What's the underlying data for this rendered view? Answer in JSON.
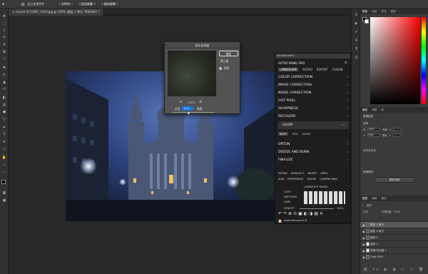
{
  "optionsbar": {
    "checkbox_label": "显示变换控件",
    "zoom": "100%",
    "fit_screen": "适合屏幕",
    "fill_screen": "填充屏幕"
  },
  "document_tab": {
    "label": "church-5173087_1920.jpg @ 100% (图层 1 拷贝, RGB/8#) *"
  },
  "dialog": {
    "title": "高反差保留",
    "ok": "确定",
    "reset": "默认值",
    "preview_label": "预览",
    "zoom": "100%",
    "radius_label": "半径",
    "radius_value": "10.0",
    "unit": "像素"
  },
  "astro": {
    "header": "AstroPanelPro",
    "title": "ASTRO PANEL PRO",
    "tabs": [
      "LANDSCAPE",
      "ASTRO",
      "EXPORT",
      "FUSION"
    ],
    "menu": [
      "COLOR CORRECTION",
      "IMAGE CORRECTION",
      "NOISE CORRECTION",
      "HOT PIXEL",
      "SHARPNESS",
      "RECOVERY"
    ],
    "glow": "GLOW",
    "glow_opts": [
      "SOFT",
      "PRO",
      "NIGHT"
    ],
    "menu2": [
      "ORTON",
      "DODGE AND BURN",
      "FINALIZE"
    ],
    "btns1": [
      "REFINE",
      "DESELECT",
      "INVERT",
      "APPLY"
    ],
    "btns2": [
      "SUM",
      "DIFFERENCE",
      "GROUP",
      "CAMERA RAW"
    ],
    "luminosity": "LUMINOSITY MASKS",
    "lum_rows": [
      "LIGHT",
      "MIDTONES",
      "DARK"
    ],
    "density": "DENSITY",
    "density_value": "100%",
    "website": "www.astropanel.it"
  },
  "rpanel": {
    "color_tabs": [
      "颜色",
      "色板",
      "渐变",
      "图案"
    ],
    "props_tabs": [
      "属性",
      "调整",
      "库"
    ],
    "props_title": "像素图层",
    "transform": "变换",
    "w": "W",
    "h": "H",
    "x": "X",
    "y": "Y",
    "w_val": "1920",
    "h_val": "1080",
    "unit": "像素",
    "align": "对齐并分布",
    "quick": "快速操作",
    "remove_bg": "删除背景",
    "layers_tabs": [
      "图层",
      "通道",
      "路径"
    ],
    "kind": "类型",
    "mode": "正常",
    "opacity_label": "不透明度",
    "opacity": "100%",
    "layers": [
      "图层 1 拷贝",
      "图层 4 拷贝",
      "图层 4",
      "曲线 1",
      "亮度/对比度 1",
      "Glow 30%"
    ]
  },
  "colors": {
    "accent": "#1473e6",
    "dialog_bg": "#535353",
    "panel_bg": "#1e1e1e"
  }
}
